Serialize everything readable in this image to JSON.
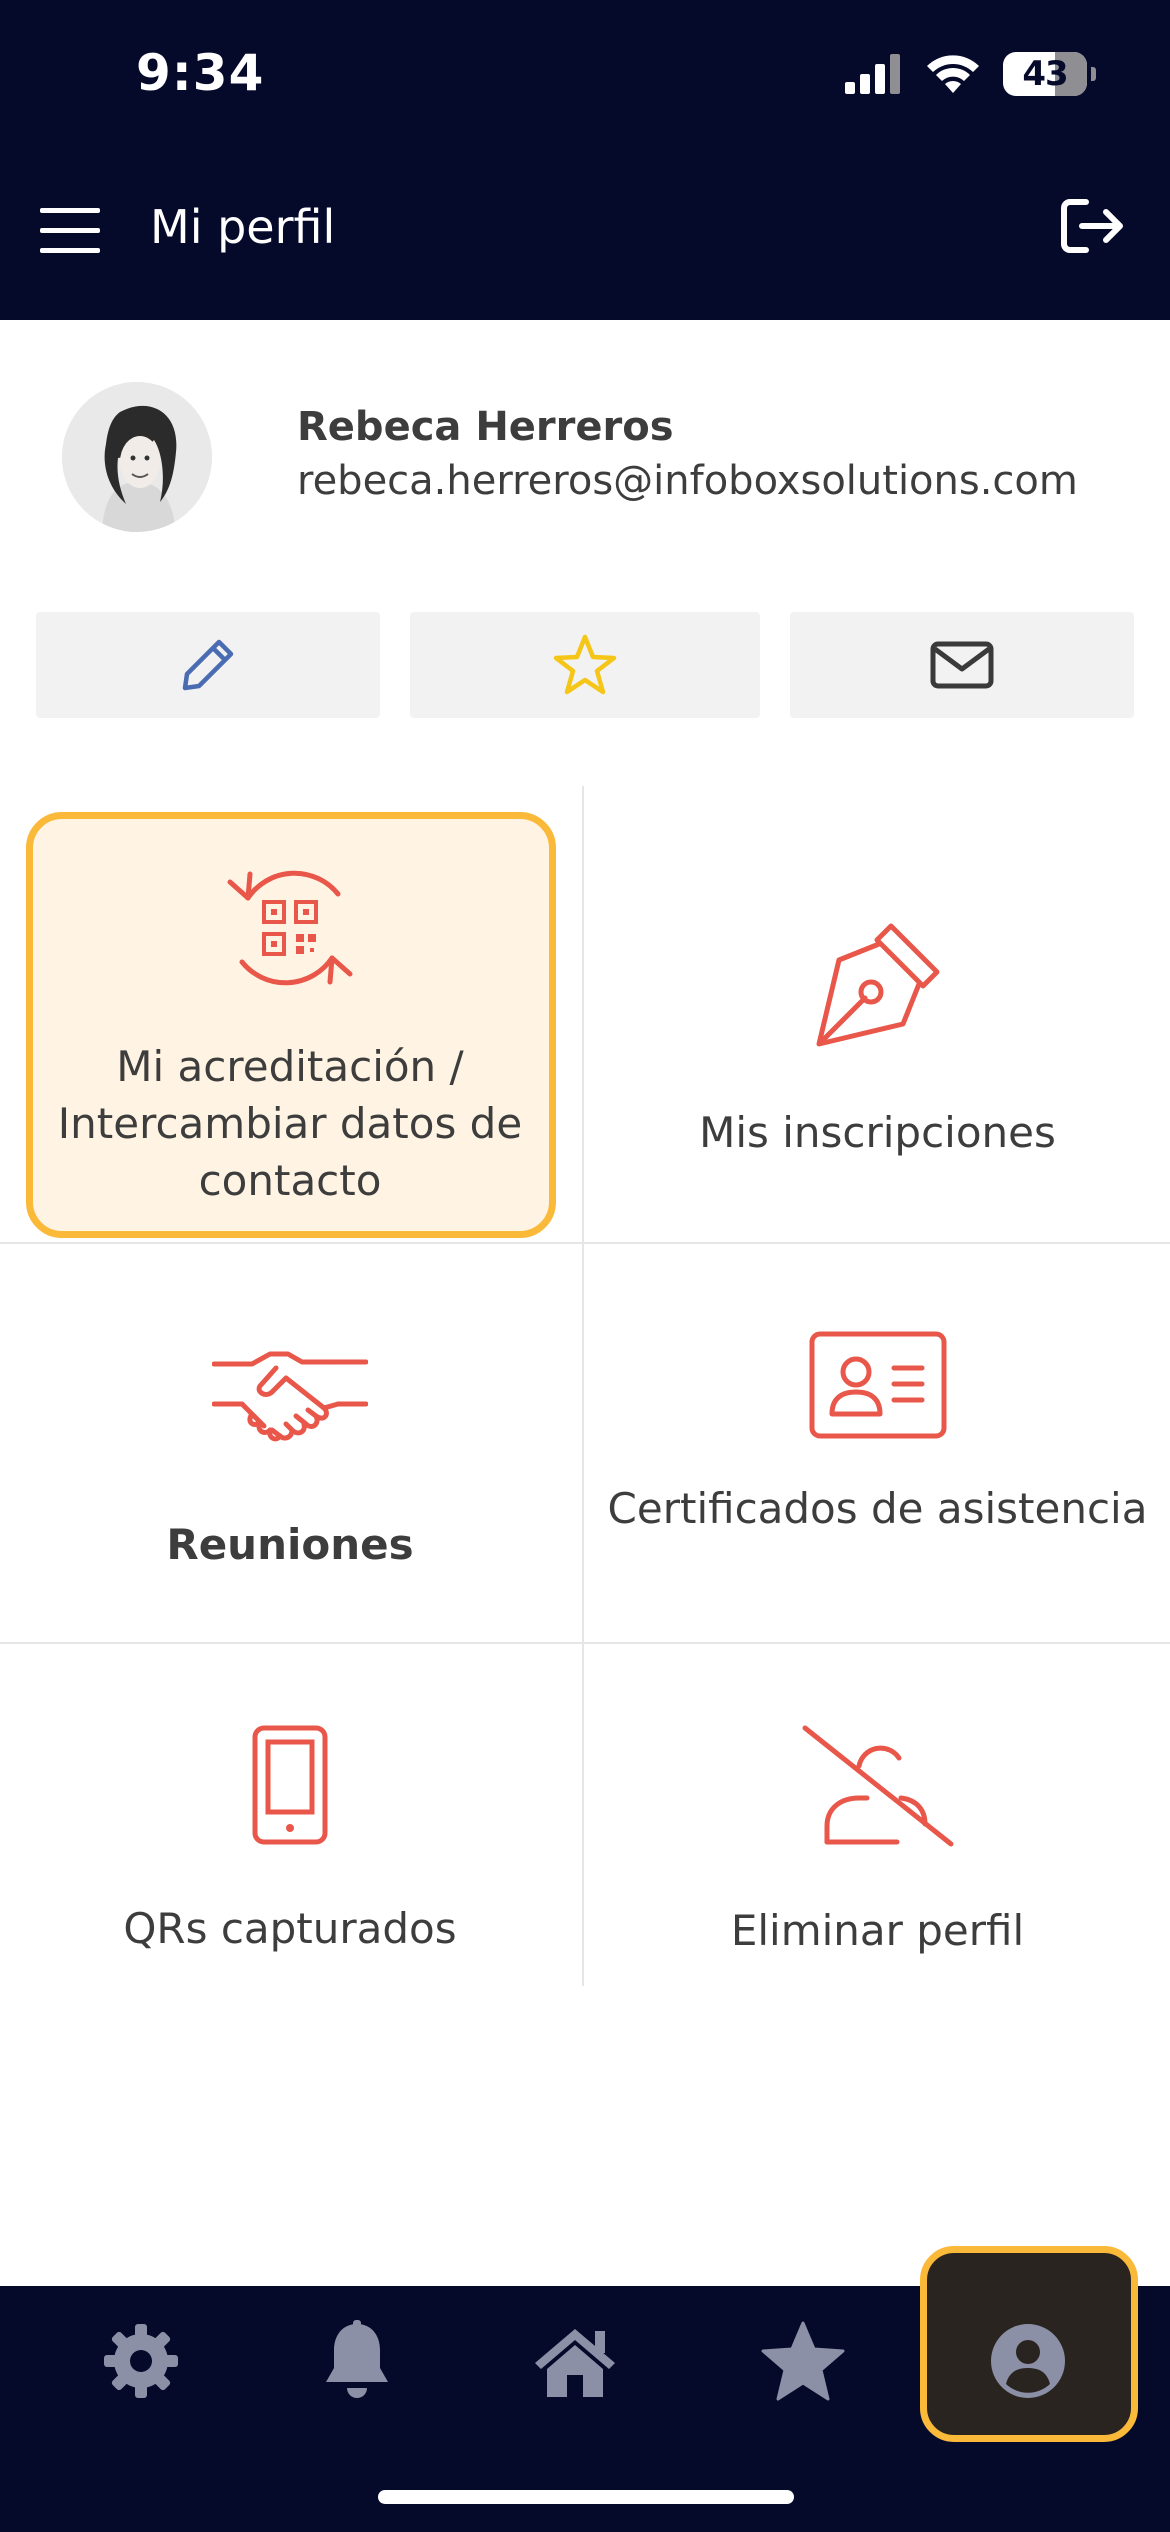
{
  "status_bar": {
    "time": "9:34",
    "battery": "43"
  },
  "header": {
    "title": "Mi perfil",
    "menu_icon": "hamburger-menu-icon",
    "logout_icon": "logout-icon"
  },
  "profile": {
    "name": "Rebeca Herreros",
    "email": "rebeca.herreros@infoboxsolutions.com"
  },
  "actions": [
    {
      "icon": "edit-pencil-icon",
      "color": "#4a6cb3"
    },
    {
      "icon": "star-outline-icon",
      "color": "#f5c518"
    },
    {
      "icon": "mail-envelope-icon",
      "color": "#3a3a3a"
    }
  ],
  "tiles": [
    {
      "label": "Mi acreditación / Intercambiar datos de contacto",
      "icon": "qr-exchange-icon"
    },
    {
      "label": "Mis inscripciones",
      "icon": "pen-nib-icon"
    },
    {
      "label": "Reuniones",
      "icon": "handshake-icon"
    },
    {
      "label": "Certificados de asistencia",
      "icon": "id-card-icon"
    },
    {
      "label": "QRs capturados",
      "icon": "smartphone-icon"
    },
    {
      "label": "Eliminar perfil",
      "icon": "user-delete-icon"
    }
  ],
  "bottom_nav": [
    {
      "icon": "settings-gear-icon"
    },
    {
      "icon": "notifications-bell-icon"
    },
    {
      "icon": "home-icon"
    },
    {
      "icon": "favorites-star-icon"
    },
    {
      "icon": "profile-user-icon",
      "active": true
    }
  ],
  "colors": {
    "navy": "#050a2b",
    "accent": "#e8574a",
    "highlight": "#fbb93a",
    "nav_icon": "#8b90a6"
  }
}
